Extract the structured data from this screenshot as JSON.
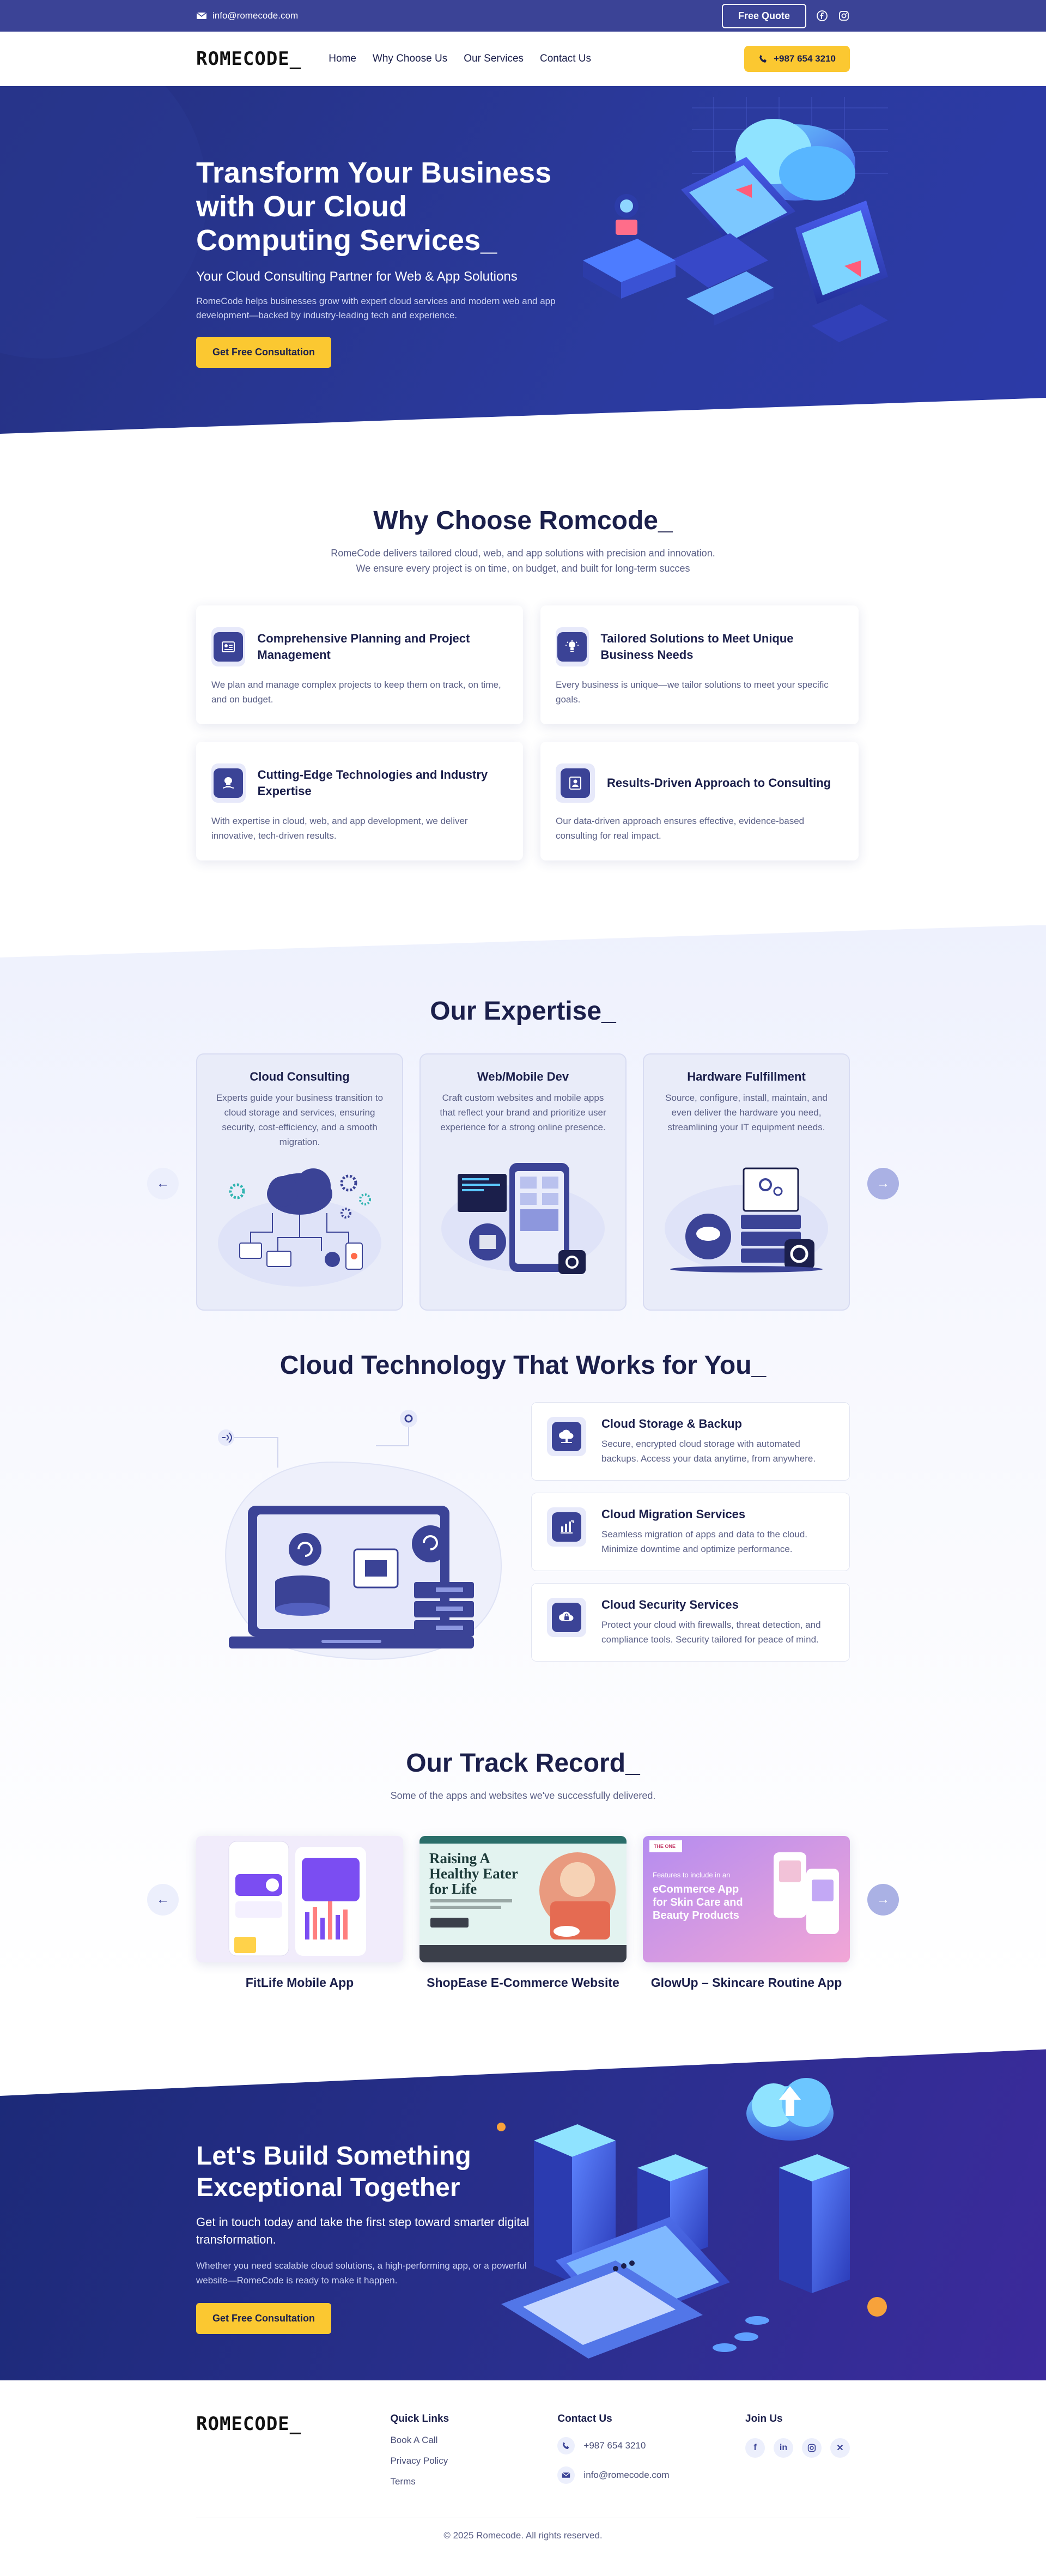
{
  "topbar": {
    "email": "info@romecode.com",
    "quote_label": "Free Quote"
  },
  "brand": {
    "logo_text": "ROMECODE_",
    "accent": "#3b4396",
    "yellow": "#fbc831"
  },
  "nav": {
    "links": [
      "Home",
      "Why Choose Us",
      "Our Services",
      "Contact Us"
    ],
    "phone": "+987 654 3210"
  },
  "hero": {
    "title": "Transform Your Business with Our Cloud Computing Services_",
    "subtitle": "Your Cloud Consulting Partner for Web & App Solutions",
    "description": "RomeCode helps businesses grow with expert cloud services and modern web and app development—backed by industry-leading tech and experience.",
    "cta": "Get Free Consultation"
  },
  "why": {
    "title": "Why Choose Romcode_",
    "subtitle_line1": "RomeCode delivers tailored cloud, web, and app solutions with precision and innovation.",
    "subtitle_line2": "We ensure every project is on time, on budget, and built for long-term succes",
    "cards": [
      {
        "title": "Comprehensive Planning and Project Management",
        "text": "We plan and manage complex projects to keep them on track, on time, and on budget.",
        "icon": "planning-icon"
      },
      {
        "title": "Tailored Solutions to Meet Unique Business Needs",
        "text": "Every business is unique—we tailor solutions to meet your specific goals.",
        "icon": "tailored-icon"
      },
      {
        "title": "Cutting-Edge Technologies and Industry Expertise",
        "text": "With expertise in cloud, web, and app development, we deliver innovative, tech-driven results.",
        "icon": "technology-icon"
      },
      {
        "title": "Results-Driven Approach to Consulting",
        "text": "Our data-driven approach ensures effective, evidence-based consulting for real impact.",
        "icon": "results-icon"
      }
    ]
  },
  "expertise": {
    "title": "Our Expertise_",
    "cards": [
      {
        "title": "Cloud Consulting",
        "text": "Experts guide your business transition to cloud storage and services, ensuring security, cost-efficiency, and a smooth migration."
      },
      {
        "title": "Web/Mobile Dev",
        "text": "Craft custom websites and mobile apps that reflect your brand and prioritize user experience for a strong online presence."
      },
      {
        "title": "Hardware Fulfillment",
        "text": "Source, configure, install, maintain, and even deliver the hardware you need, streamlining your IT equipment needs."
      }
    ]
  },
  "cloudtech": {
    "title": "Cloud Technology That Works for You_",
    "items": [
      {
        "title": "Cloud Storage & Backup",
        "text": "Secure, encrypted cloud storage with automated backups. Access your data anytime, from anywhere.",
        "icon": "cloud-storage-icon"
      },
      {
        "title": "Cloud Migration Services",
        "text": "Seamless migration of apps and data to the cloud. Minimize downtime and optimize performance.",
        "icon": "migration-icon"
      },
      {
        "title": "Cloud Security Services",
        "text": "Protect your cloud with firewalls, threat detection, and compliance tools. Security tailored for peace of mind.",
        "icon": "security-icon"
      }
    ]
  },
  "track": {
    "title": "Our Track Record_",
    "subtitle": "Some of the apps and websites we've successfully delivered.",
    "projects": [
      {
        "name": "FitLife Mobile App"
      },
      {
        "name": "ShopEase E-Commerce Website",
        "image_text": "Raising A Healthy Eater for Life"
      },
      {
        "name": "GlowUp – Skincare Routine App",
        "image_text": "eCommerce App for Skin Care and Beauty Products",
        "image_small": "Features to include in an",
        "badge": "THE ONE"
      }
    ]
  },
  "cta": {
    "title": "Let's Build Something Exceptional Together",
    "subtitle": "Get in touch today and take the first step toward smarter digital transformation.",
    "description": "Whether you need scalable cloud solutions, a high-performing app, or a powerful website—RomeCode is ready to make it happen.",
    "button": "Get Free Consultation"
  },
  "footer": {
    "quick_links_title": "Quick Links",
    "quick_links": [
      "Book A Call",
      "Privacy Policy",
      "Terms"
    ],
    "contact_title": "Contact Us",
    "phone": "+987 654 3210",
    "email": "info@romecode.com",
    "join_title": "Join Us",
    "socials": [
      "facebook-icon",
      "linkedin-icon",
      "instagram-icon",
      "x-icon"
    ],
    "copyright": "© 2025 Romecode. All rights reserved."
  }
}
